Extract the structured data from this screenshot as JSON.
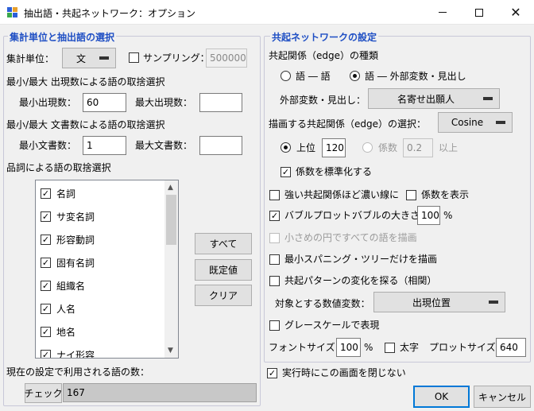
{
  "window": {
    "title": "抽出語・共起ネットワーク：オプション",
    "minimize_icon": "minimize-icon",
    "maximize_icon": "maximize-icon",
    "close_icon": "close-icon"
  },
  "left": {
    "group_title": "集計単位と抽出語の選択",
    "unit_label": "集計単位：",
    "unit_value": "文",
    "sampling_label": "サンプリング：",
    "sampling_checked": false,
    "sampling_value": "500000",
    "freq_heading": "最小/最大 出現数による語の取捨選択",
    "min_freq_label": "最小出現数：",
    "min_freq_value": "60",
    "max_freq_label": "最大出現数：",
    "max_freq_value": "",
    "doc_heading": "最小/最大 文書数による語の取捨選択",
    "min_doc_label": "最小文書数：",
    "min_doc_value": "1",
    "max_doc_label": "最大文書数：",
    "max_doc_value": "",
    "pos_heading": "品詞による語の取捨選択",
    "pos_items": [
      {
        "label": "名詞",
        "checked": true
      },
      {
        "label": "サ変名詞",
        "checked": true
      },
      {
        "label": "形容動詞",
        "checked": true
      },
      {
        "label": "固有名詞",
        "checked": true
      },
      {
        "label": "組織名",
        "checked": true
      },
      {
        "label": "人名",
        "checked": true
      },
      {
        "label": "地名",
        "checked": true
      },
      {
        "label": "ナイ形容",
        "checked": true
      }
    ],
    "btn_all": "すべて",
    "btn_default": "既定値",
    "btn_clear": "クリア",
    "count_label": "現在の設定で利用される語の数：",
    "check_button": "チェック",
    "count_value": "167"
  },
  "right": {
    "group_title": "共起ネットワークの設定",
    "edge_type_label": "共起関係（edge）の種類",
    "radio_word_word": "語 ― 語",
    "radio_word_var": "語 ― 外部変数・見出し",
    "edge_type_selected": "word_var",
    "ext_var_label": "外部変数・見出し：",
    "ext_var_value": "名寄せ出願人",
    "draw_edge_label": "描画する共起関係（edge）の選択：",
    "draw_edge_value": "Cosine",
    "top_label": "上位",
    "top_value": "120",
    "coef_label": "係数",
    "coef_value": "0.2",
    "coef_suffix": "以上",
    "standardize_label": "係数を標準化する",
    "standardize_checked": true,
    "strong_dark_label": "強い共起関係ほど濃い線に",
    "strong_dark_checked": false,
    "show_coef_label": "係数を表示",
    "show_coef_checked": false,
    "bubble_label": "バブルプロット：",
    "bubble_checked": true,
    "bubble_size_label": "バブルの大きさ",
    "bubble_size_value": "100",
    "percent": "%",
    "small_circle_label": "小さめの円ですべての語を描画",
    "small_circle_checked": false,
    "mst_label": "最小スパニング・ツリーだけを描画",
    "mst_checked": false,
    "pattern_label": "共起パターンの変化を探る（相関）",
    "pattern_checked": false,
    "target_var_label": "対象とする数値変数：",
    "target_var_value": "出現位置",
    "grayscale_label": "グレースケールで表現",
    "grayscale_checked": false,
    "font_size_label": "フォントサイズ：",
    "font_size_value": "100",
    "bold_label": "太字",
    "bold_checked": false,
    "plot_size_label": "プロットサイズ：",
    "plot_size_value": "640"
  },
  "bottom": {
    "keep_open_label": "実行時にこの画面を閉じない",
    "keep_open_checked": true,
    "ok_label": "OK",
    "cancel_label": "キャンセル"
  },
  "colors": {
    "group_title": "#1f4fc4",
    "focus_border": "#0078d7"
  }
}
